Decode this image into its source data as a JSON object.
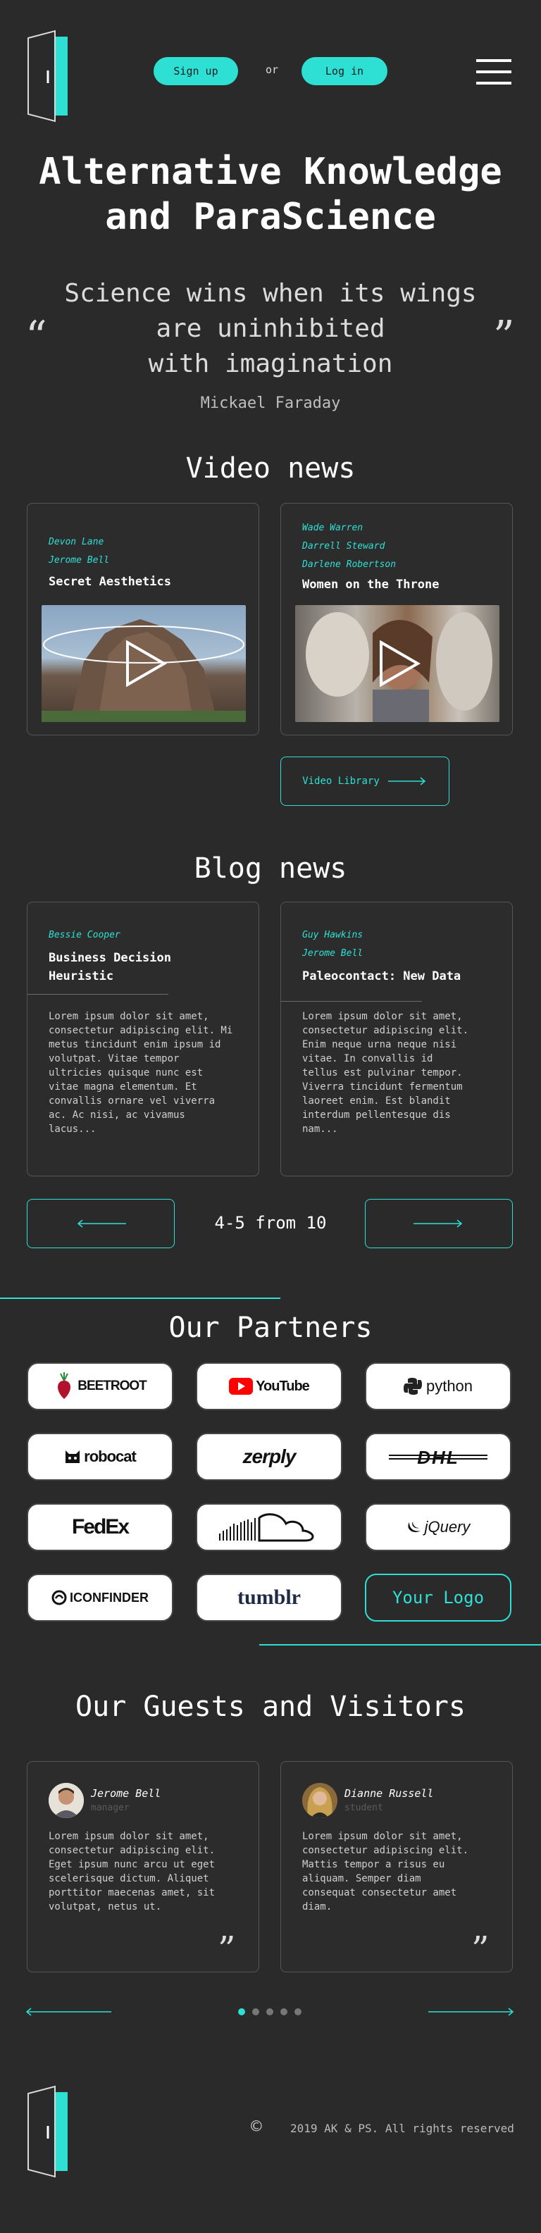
{
  "header": {
    "signup_label": "Sign up",
    "or_label": "or",
    "login_label": "Log in"
  },
  "hero": {
    "title_line1": "Alternative Knowledge",
    "title_line2": "and ParaScience",
    "quote_line1": "Science wins when its wings",
    "quote_line2": "are uninhibited",
    "quote_line3": "with imagination",
    "quote_author": "Mickael Faraday"
  },
  "video_news": {
    "title": "Video news",
    "cards": [
      {
        "authors": [
          "Devon Lane",
          "Jerome Bell"
        ],
        "title": "Secret Aesthetics"
      },
      {
        "authors": [
          "Wade Warren",
          "Darrell Steward",
          "Darlene Robertson"
        ],
        "title": "Women on the Throne"
      }
    ],
    "library_label": "Video Library"
  },
  "blog_news": {
    "title": "Blog news",
    "cards": [
      {
        "authors": [
          "Bessie Cooper"
        ],
        "title_line1": "Business Decision",
        "title_line2": "Heuristic",
        "body": [
          "Lorem ipsum dolor sit amet,",
          "consectetur adipiscing elit. Mi",
          "metus tincidunt enim ipsum id",
          "volutpat. Vitae tempor",
          "ultricies quisque nunc est",
          "vitae magna elementum. Et",
          "convallis ornare vel viverra",
          "ac. Ac nisi, ac vivamus",
          "lacus..."
        ]
      },
      {
        "authors": [
          "Guy Hawkins",
          "Jerome Bell"
        ],
        "title_line1": "Paleocontact: New Data",
        "body": [
          "Lorem ipsum dolor sit amet,",
          "consectetur adipiscing elit.",
          "Enim neque urna neque nisi",
          "vitae. In convallis id",
          "tellus est pulvinar tempor.",
          "Viverra tincidunt fermentum",
          "laoreet enim. Est blandit",
          "interdum pellentesque dis",
          "nam..."
        ]
      }
    ],
    "pagination_label": "4-5 from 10"
  },
  "partners": {
    "title": "Our Partners",
    "items": [
      "BEETROOT",
      "YouTube",
      "python",
      "robocat",
      "zerply",
      "DHL",
      "FedEx",
      "",
      "jQuery",
      "ICONFINDER",
      "tumblr",
      "Your Logo"
    ]
  },
  "guests": {
    "title": "Our Guests and Visitors",
    "cards": [
      {
        "name": "Jerome Bell",
        "role": "manager",
        "body": [
          "Lorem ipsum dolor sit amet,",
          "consectetur adipiscing elit.",
          "Eget ipsum nunc arcu ut eget",
          "scelerisque dictum. Aliquet",
          "porttitor maecenas amet, sit",
          "volutpat, netus ut."
        ]
      },
      {
        "name": "Dianne Russell",
        "role": "student",
        "body": [
          "Lorem ipsum dolor sit amet,",
          "consectetur adipiscing elit.",
          "Mattis tempor a risus eu",
          "aliquam. Semper diam",
          "consequat consectetur amet",
          "diam."
        ]
      }
    ],
    "active_page": 1,
    "pages": 5
  },
  "footer": {
    "copyright_symbol": "©",
    "copyright_text": "2019 AK & PS. All rights reserved"
  },
  "colors": {
    "accent": "#2ee0d4",
    "background": "#2a2a2a",
    "card_border": "#555555"
  }
}
